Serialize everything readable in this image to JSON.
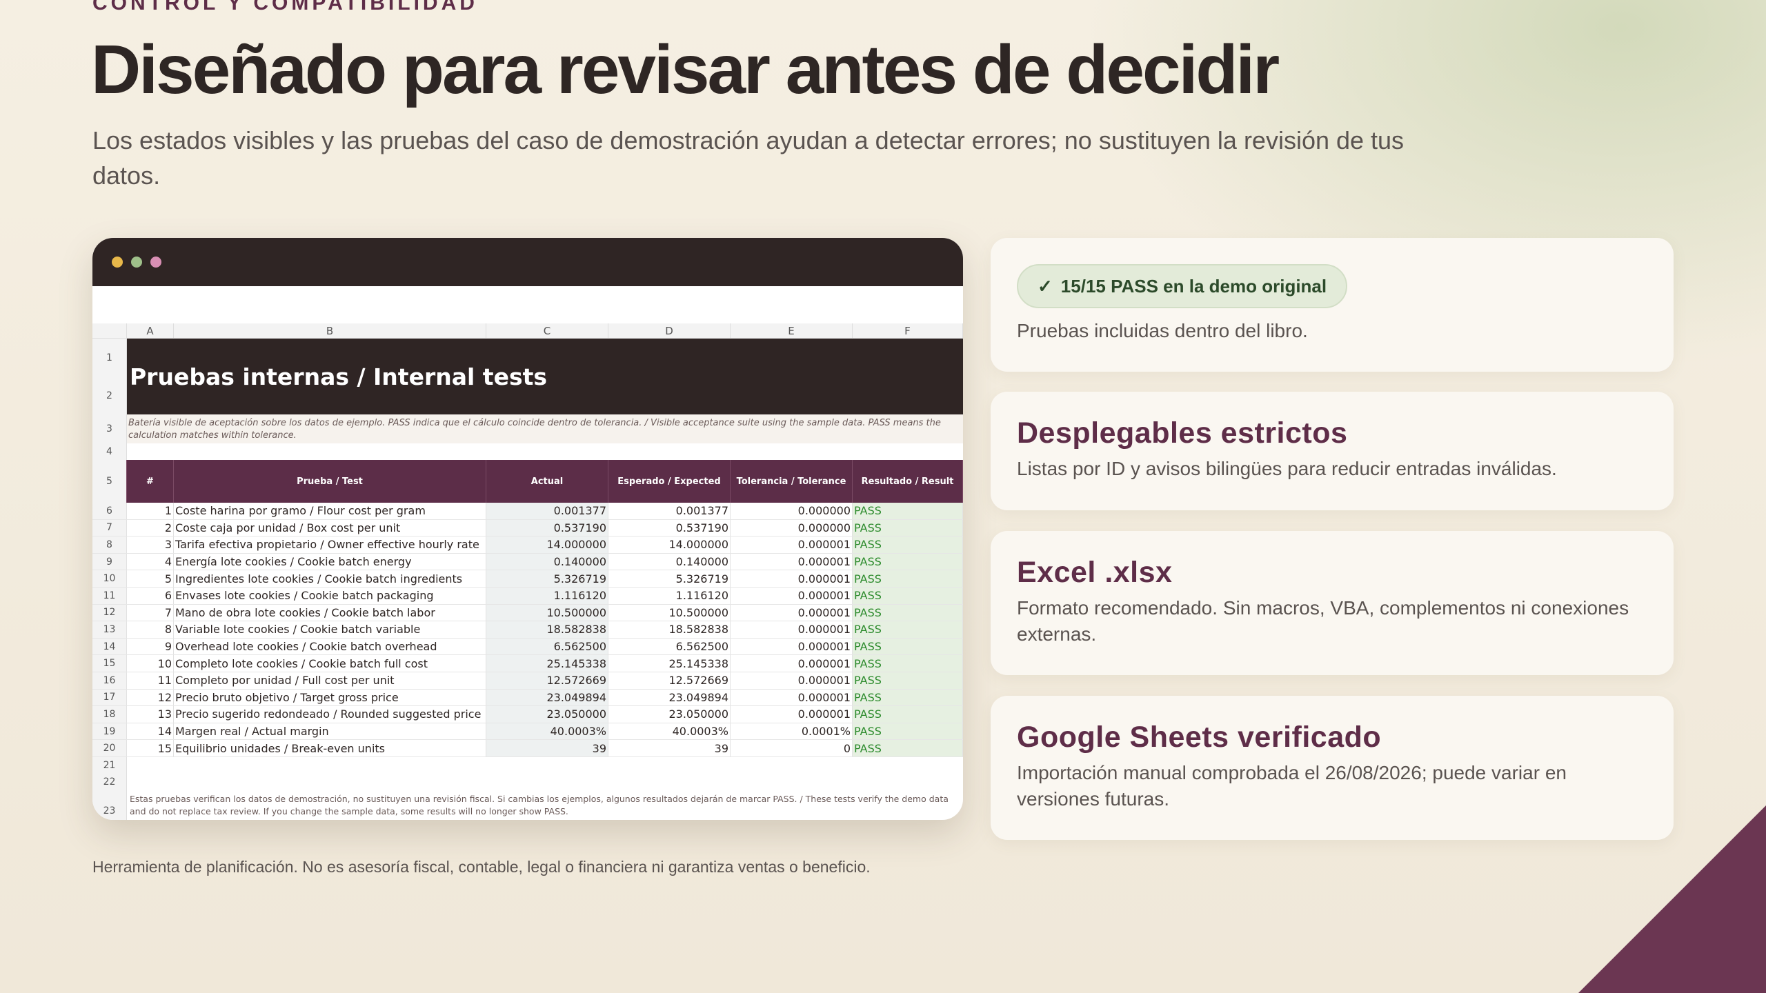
{
  "header": {
    "eyebrow": "CONTROL Y COMPATIBILIDAD",
    "headline": "Diseñado para revisar antes de decidir",
    "subtitle": "Los estados visibles y las pruebas del caso de demostración ayudan a detectar errores; no sustituyen la revisión de tus datos."
  },
  "window": {
    "dot_colors": [
      "#e8b84a",
      "#9fc08a",
      "#d98fb4"
    ]
  },
  "sheet": {
    "columns": [
      "A",
      "B",
      "C",
      "D",
      "E",
      "F"
    ],
    "title": "Pruebas internas / Internal tests",
    "description": "Batería visible de aceptación sobre los datos de ejemplo. PASS indica que el cálculo coincide dentro de tolerancia. / Visible acceptance suite using the sample data. PASS means the calculation matches within tolerance.",
    "headers": [
      "#",
      "Prueba / Test",
      "Actual",
      "Esperado / Expected",
      "Tolerancia / Tolerance",
      "Resultado / Result"
    ],
    "rows": [
      {
        "n": "1",
        "test": "Coste harina por gramo / Flour cost per gram",
        "actual": "0.001377",
        "expected": "0.001377",
        "tol": "0.000000",
        "result": "PASS"
      },
      {
        "n": "2",
        "test": "Coste caja por unidad / Box cost per unit",
        "actual": "0.537190",
        "expected": "0.537190",
        "tol": "0.000000",
        "result": "PASS"
      },
      {
        "n": "3",
        "test": "Tarifa efectiva propietario / Owner effective hourly rate",
        "actual": "14.000000",
        "expected": "14.000000",
        "tol": "0.000001",
        "result": "PASS"
      },
      {
        "n": "4",
        "test": "Energía lote cookies / Cookie batch energy",
        "actual": "0.140000",
        "expected": "0.140000",
        "tol": "0.000001",
        "result": "PASS"
      },
      {
        "n": "5",
        "test": "Ingredientes lote cookies / Cookie batch ingredients",
        "actual": "5.326719",
        "expected": "5.326719",
        "tol": "0.000001",
        "result": "PASS"
      },
      {
        "n": "6",
        "test": "Envases lote cookies / Cookie batch packaging",
        "actual": "1.116120",
        "expected": "1.116120",
        "tol": "0.000001",
        "result": "PASS"
      },
      {
        "n": "7",
        "test": "Mano de obra lote cookies / Cookie batch labor",
        "actual": "10.500000",
        "expected": "10.500000",
        "tol": "0.000001",
        "result": "PASS"
      },
      {
        "n": "8",
        "test": "Variable lote cookies / Cookie batch variable",
        "actual": "18.582838",
        "expected": "18.582838",
        "tol": "0.000001",
        "result": "PASS"
      },
      {
        "n": "9",
        "test": "Overhead lote cookies / Cookie batch overhead",
        "actual": "6.562500",
        "expected": "6.562500",
        "tol": "0.000001",
        "result": "PASS"
      },
      {
        "n": "10",
        "test": "Completo lote cookies / Cookie batch full cost",
        "actual": "25.145338",
        "expected": "25.145338",
        "tol": "0.000001",
        "result": "PASS"
      },
      {
        "n": "11",
        "test": "Completo por unidad / Full cost per unit",
        "actual": "12.572669",
        "expected": "12.572669",
        "tol": "0.000001",
        "result": "PASS"
      },
      {
        "n": "12",
        "test": "Precio bruto objetivo / Target gross price",
        "actual": "23.049894",
        "expected": "23.049894",
        "tol": "0.000001",
        "result": "PASS"
      },
      {
        "n": "13",
        "test": "Precio sugerido redondeado / Rounded suggested price",
        "actual": "23.050000",
        "expected": "23.050000",
        "tol": "0.000001",
        "result": "PASS"
      },
      {
        "n": "14",
        "test": "Margen real / Actual margin",
        "actual": "40.0003%",
        "expected": "40.0003%",
        "tol": "0.0001%",
        "result": "PASS"
      },
      {
        "n": "15",
        "test": "Equilibrio unidades / Break-even units",
        "actual": "39",
        "expected": "39",
        "tol": "0",
        "result": "PASS"
      }
    ],
    "footer_note": "Estas pruebas verifican los datos de demostración, no sustituyen una revisión fiscal. Si cambias los ejemplos, algunos resultados dejarán de marcar PASS. / These tests verify the demo data and do not replace tax review. If you change the sample data, some results will no longer show PASS."
  },
  "cards": [
    {
      "pill": "15/15 PASS en la demo original",
      "pill_icon": "check-icon",
      "body": "Pruebas incluidas dentro del libro."
    },
    {
      "title": "Desplegables estrictos",
      "body": "Listas por ID y avisos bilingües para reducir entradas inválidas."
    },
    {
      "title": "Excel .xlsx",
      "body": "Formato recomendado. Sin macros, VBA, complementos ni conexiones externas."
    },
    {
      "title": "Google Sheets verificado",
      "body": "Importación manual comprobada el 26/08/2026; puede variar en versiones futuras."
    }
  ],
  "disclaimer": "Herramienta de planificación. No es asesoría fiscal, contable, legal o financiera ni garantiza ventas o beneficio.",
  "colors": {
    "accent": "#5e2d48",
    "dark": "#2f2524",
    "pass": "#2b8a2b"
  }
}
